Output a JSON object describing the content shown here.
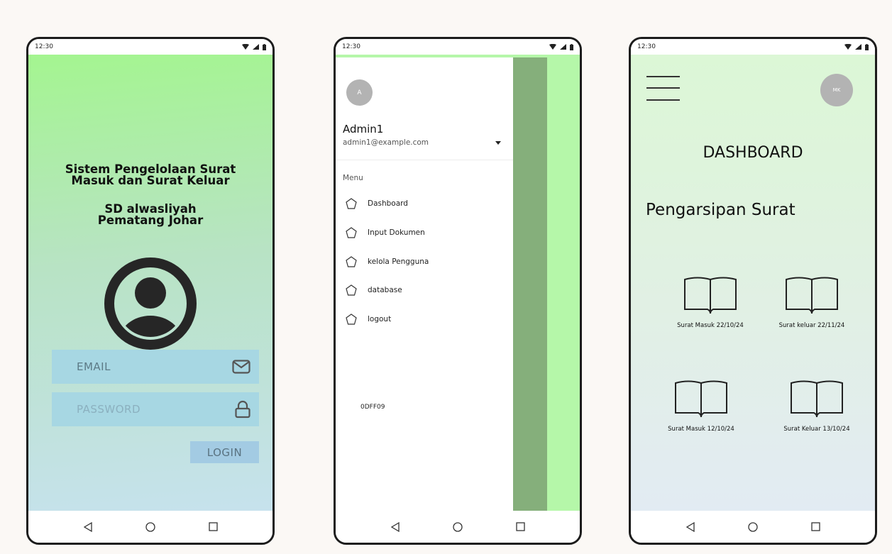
{
  "status_bar": {
    "time": "12:30"
  },
  "login": {
    "title_line1": "Sistem Pengelolaan Surat",
    "title_line2": "Masuk dan Surat Keluar",
    "school_line1": "SD alwasliyah",
    "school_line2": "Pematang Johar",
    "email_placeholder": "EMAIL",
    "password_placeholder": "PASSWORD",
    "login_label": "LOGIN"
  },
  "drawer": {
    "avatar_initial": "A",
    "user_name": "Admin1",
    "user_email": "admin1@example.com",
    "menu_label": "Menu",
    "items": [
      {
        "label": "Dashboard"
      },
      {
        "label": "Input Dokumen"
      },
      {
        "label": "kelola Pengguna"
      },
      {
        "label": "database"
      },
      {
        "label": "logout"
      }
    ],
    "color_code": "0DFF09"
  },
  "dashboard": {
    "avatar_initials": "MK",
    "title": "DASHBOARD",
    "subtitle": "Pengarsipan Surat",
    "documents": [
      {
        "label": "Surat Masuk 22/10/24"
      },
      {
        "label": "Surat keluar 22/11/24"
      },
      {
        "label": "Surat Masuk 12/10/24"
      },
      {
        "label": "Surat Keluar 13/10/24"
      }
    ]
  },
  "colors": {
    "login_bg_top": "#a4f590",
    "login_bg_bottom": "#c6e2ed",
    "input_bg": "#a7d7e3",
    "login_button_bg": "#a3cbe3",
    "drawer_scrim": "#85af7b",
    "drawer_side": "#b5f7a9",
    "dashboard_bg_top": "#dcf7d6"
  },
  "icons": [
    "wifi-icon",
    "cellular-icon",
    "battery-icon",
    "back-icon",
    "home-icon",
    "recents-icon",
    "user-avatar-icon",
    "mail-icon",
    "lock-icon",
    "pentagon-icon",
    "hamburger-icon",
    "book-icon"
  ]
}
